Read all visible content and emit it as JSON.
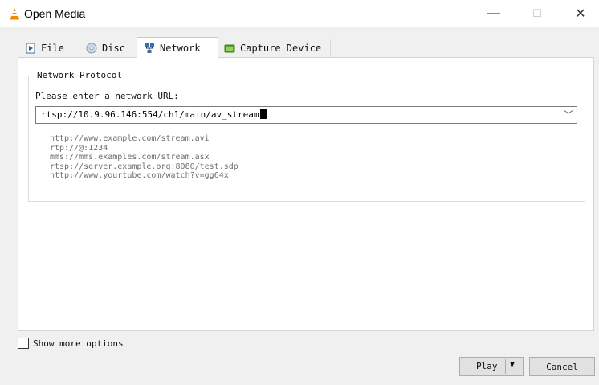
{
  "window": {
    "title": "Open Media",
    "minimize": "—",
    "maximize": "☐",
    "close": "✕"
  },
  "tabs": [
    {
      "label": "File",
      "icon": "file-icon"
    },
    {
      "label": "Disc",
      "icon": "disc-icon"
    },
    {
      "label": "Network",
      "icon": "network-icon",
      "active": true
    },
    {
      "label": "Capture Device",
      "icon": "capture-device-icon"
    }
  ],
  "network": {
    "group_label": "Network Protocol",
    "prompt": "Please enter a network URL:",
    "url_value": "rtsp://10.9.96.146:554/ch1/main/av_stream",
    "examples": [
      "http://www.example.com/stream.avi",
      "rtp://@:1234",
      "mms://mms.examples.com/stream.asx",
      "rtsp://server.example.org:8080/test.sdp",
      "http://www.yourtube.com/watch?v=gg64x"
    ]
  },
  "options": {
    "show_more_label": "Show more options",
    "checked": false
  },
  "buttons": {
    "play_label": "Play",
    "cancel_label": "Cancel"
  },
  "colors": {
    "vlc_orange": "#f28a00",
    "window_bg": "#f0f0f0",
    "panel_bg": "#ffffff"
  }
}
